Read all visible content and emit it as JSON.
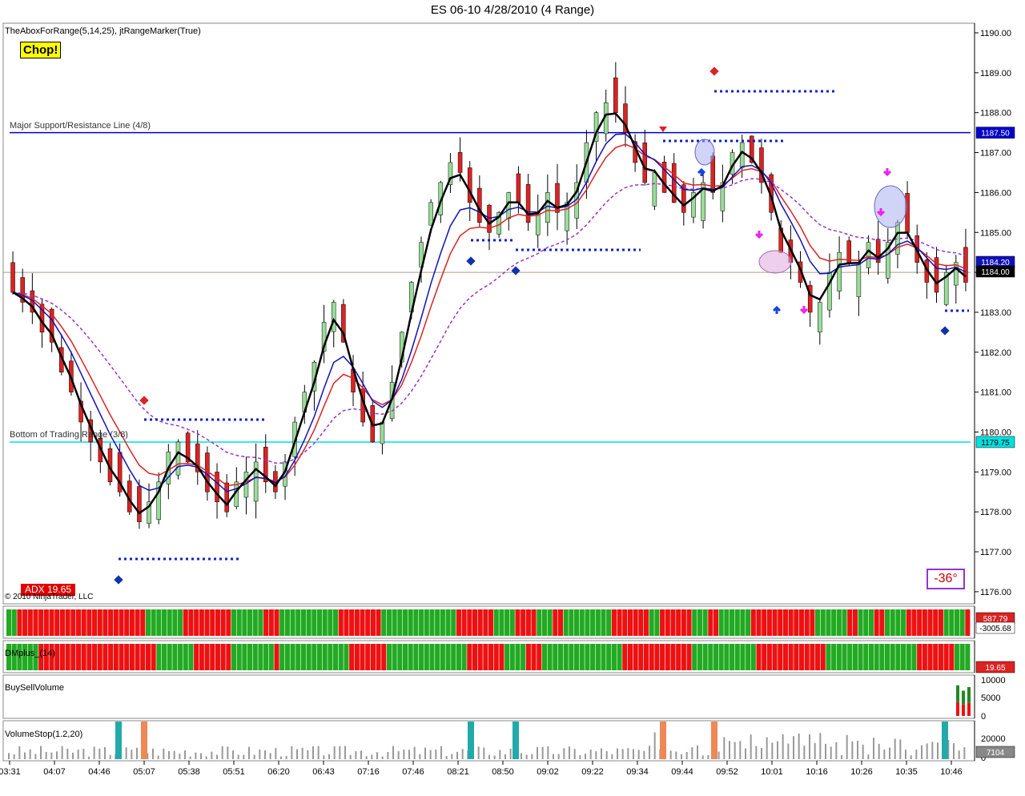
{
  "window": {
    "title": "ES 06-10  4/28/2010 (4 Range)"
  },
  "price_panel": {
    "indicator_label": "TheAboxForRange(5,14,25), jtRangeMarker(True)",
    "chop_badge": "Chop!",
    "adx_badge": "ADX 19.65",
    "copyright": "© 2010 NinjaTrader, LLC",
    "angle_box": "-36°",
    "support_line_label": "Major Support/Resistance Line (4/8)",
    "bottom_line_label": "Bottom of Trading Range (3/8)",
    "support_price_tag": "1187.50",
    "bottom_price_tag": "1179.75",
    "last_price_tag": "1184.00",
    "ma_price_tag": "1184.20",
    "colors": {
      "up": "#99dd99",
      "down": "#dd2222",
      "support": "#0000cc",
      "bottom": "#00e0e0"
    }
  },
  "strip1": {
    "tag_top": "587.79",
    "tag_bottom": "-3005.68"
  },
  "strip2": {
    "label": "DMplus_(14)",
    "tag": "19.65"
  },
  "buysell": {
    "label": "BuySellVolume",
    "ticks": [
      "10000",
      "5000",
      "0"
    ]
  },
  "volstop": {
    "label": "VolumeStop(1.2,20)",
    "ticks": [
      "20000",
      "0"
    ],
    "tag": "7104"
  },
  "chart_data": {
    "type": "candlestick",
    "y_axis": {
      "ticks": [
        "1190.00",
        "1189.00",
        "1188.00",
        "1187.00",
        "1186.00",
        "1185.00",
        "1184.00",
        "1183.00",
        "1182.00",
        "1181.00",
        "1180.00",
        "1179.00",
        "1178.00",
        "1177.00",
        "1176.00"
      ],
      "ylim": [
        1175.7,
        1190.2
      ]
    },
    "x_axis": {
      "ticks": [
        "03:31",
        "04:07",
        "04:46",
        "05:07",
        "05:38",
        "05:51",
        "06:20",
        "06:43",
        "07:16",
        "07:46",
        "08:21",
        "08:50",
        "09:02",
        "09:22",
        "09:34",
        "09:44",
        "09:52",
        "10:01",
        "10:16",
        "10:26",
        "10:35",
        "10:46"
      ]
    },
    "hlines": [
      1187.5,
      1179.75,
      1184.0
    ],
    "close_path": [
      1183.5,
      1183.25,
      1183.0,
      1182.5,
      1182.25,
      1181.5,
      1181.0,
      1180.25,
      1179.75,
      1179.25,
      1178.75,
      1178.5,
      1178.0,
      1177.75,
      1178.25,
      1178.75,
      1179.5,
      1179.75,
      1179.25,
      1179.0,
      1178.5,
      1178.25,
      1178.0,
      1178.75,
      1179.0,
      1179.25,
      1178.75,
      1178.5,
      1179.25,
      1180.25,
      1181.0,
      1181.75,
      1182.75,
      1183.25,
      1182.25,
      1181.0,
      1180.25,
      1179.75,
      1180.25,
      1181.25,
      1182.5,
      1183.75,
      1184.75,
      1185.75,
      1186.25,
      1186.75,
      1186.5,
      1185.75,
      1185.25,
      1185.0,
      1185.5,
      1186.0,
      1185.75,
      1185.25,
      1185.5,
      1186.0,
      1185.5,
      1185.75,
      1186.25,
      1187.25,
      1188.0,
      1188.25,
      1188.0,
      1187.5,
      1186.75,
      1186.25,
      1186.5,
      1186.0,
      1185.75,
      1185.5,
      1186.0,
      1186.25,
      1186.0,
      1186.25,
      1187.0,
      1187.25,
      1186.75,
      1186.25,
      1185.5,
      1184.5,
      1184.25,
      1183.75,
      1183.0,
      1183.25,
      1184.0,
      1184.5,
      1184.25,
      1184.25,
      1184.75,
      1184.25,
      1184.75,
      1185.25,
      1185.0,
      1184.25,
      1183.75,
      1183.5,
      1184.0,
      1184.25,
      1183.75
    ]
  }
}
